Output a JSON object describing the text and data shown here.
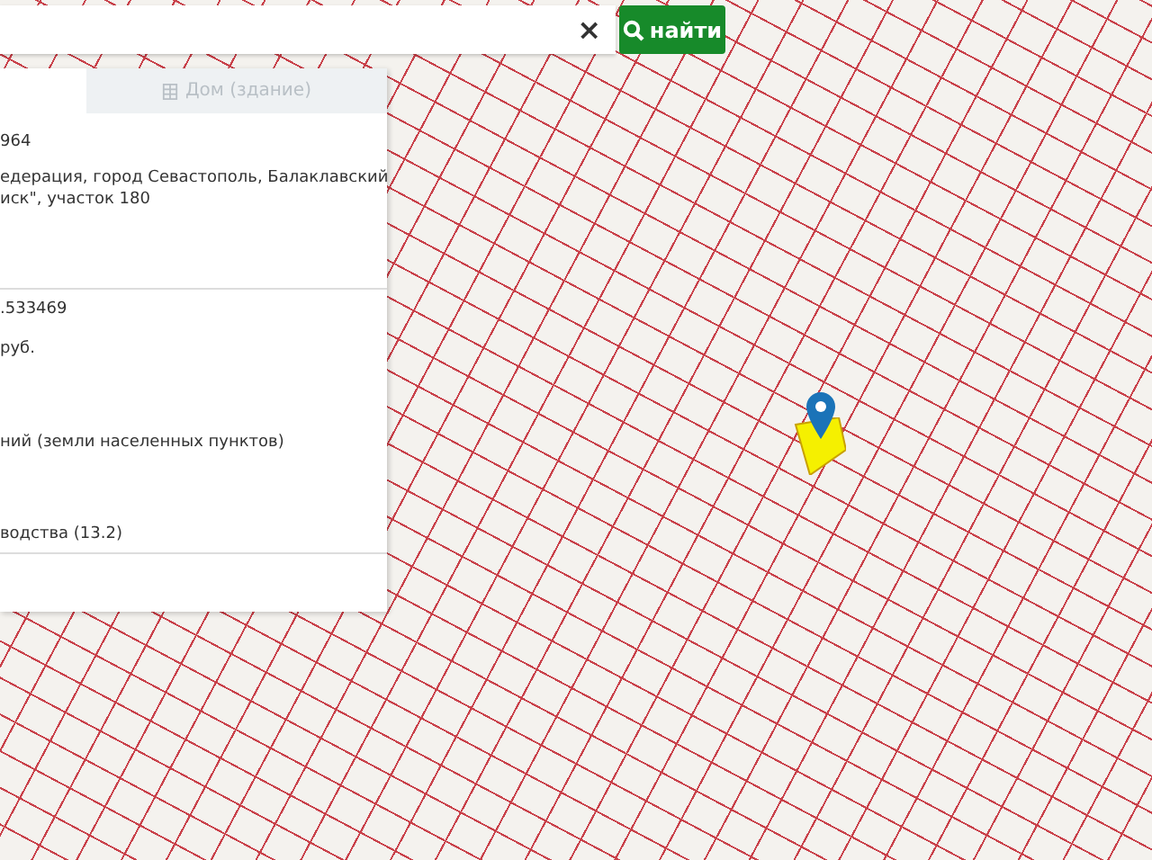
{
  "search": {
    "clear": "×",
    "button": "найти"
  },
  "panel": {
    "tabs": [
      {
        "label": "Дом (здание)",
        "selected": false
      }
    ],
    "sections": [
      {
        "rows": [
          "964",
          "едерация, город Севастополь, Балаклавский",
          "иск\", участок 180"
        ]
      },
      {
        "rows": [
          ".533469",
          "руб.",
          "ний (земли населенных пунктов)",
          "водства (13.2)"
        ]
      }
    ]
  }
}
